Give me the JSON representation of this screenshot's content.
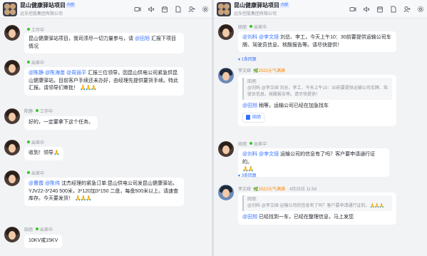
{
  "header": {
    "title": "昆山健康驿站项目",
    "tag": "内部",
    "org": "远东控股集团有限公司",
    "icons": [
      "video-icon",
      "mute-icon",
      "calendar-icon",
      "document-icon",
      "add-member-icon",
      "settings-icon"
    ]
  },
  "left": {
    "messages": [
      {
        "sender": "",
        "status": "工作中",
        "text_a": "昆山健康驿站项目，我司须尽一切力量参与，请 ",
        "mention": "@田旭",
        "text_b": " 汇报下项目情况"
      },
      {
        "sender": "",
        "status": "出差中",
        "mentions": "@陈静 @陈海苗 @周丽平",
        "text": " 汇报三位领导，因昆山供电公司紧急供昆山健康驿站，目前客户手续还未办好，由经理先提供要货手续。特此汇报。请领导们审批！",
        "claps": "🙏🙏🙏"
      },
      {
        "sender": "陈静",
        "status": "工作中",
        "text": "好的，一定要拿下这个任务。"
      },
      {
        "sender": "",
        "status": "出差中",
        "text": "收到！领导",
        "claps": "🙏"
      },
      {
        "sender": "",
        "status": "出差中",
        "mentions": "@曹霞 @陈伟",
        "text": " 沈杰经理的紧急订单:昆山供电公司发昆山健康驿站，YJV22-3*240  500米，3*120加3*150 二盘，每盘500米以上。请速查库存。今天要发货！",
        "claps": "🙏🙏🙏"
      },
      {
        "sender": "田旭",
        "status": "出差中",
        "text": "10KV或15KV"
      }
    ]
  },
  "right": {
    "messages": [
      {
        "sender": "田旭",
        "status": "出差中",
        "mentions": "@刘科 @李文娅",
        "text": " 刘总、李工，今天上午10：30前要提供运输公司车牌、驾驶员信息、核酸报告等。请尽快提供！",
        "thread": "1条回复"
      },
      {
        "sender": "李文娅",
        "badge": "2022元气满满",
        "quote_name": "田旭:",
        "quote_text": "@刘科 @李文娅  刘总、李工，今天上午10：30前要提供运输公司车牌、驾驶员信息、核酸报告等。请尽快提供！",
        "mention": "@田旭",
        "text": " 稍等，运输公司已经在加急找车",
        "doc": "田旭"
      },
      {
        "sender": "田旭",
        "status": "出差中",
        "mentions": "@刘科 @李文娅",
        "text": " 运输公司的信息有了吗？客户要申请通行证的。",
        "claps": "🙏🙏",
        "thread": "3条回复"
      },
      {
        "sender": "李文娅",
        "badge": "2022元气满满",
        "time": "4月25日 11:54",
        "quote_name": "田旭:",
        "quote_text": "@刘科 @李文娅 运输公司的信息有了吗？客户要申请通行证的。",
        "quote_claps": "🙏🙏🙏",
        "mention": "@田旭",
        "text": " 已经找到一车，已经在整理信息，马上发您"
      }
    ]
  }
}
